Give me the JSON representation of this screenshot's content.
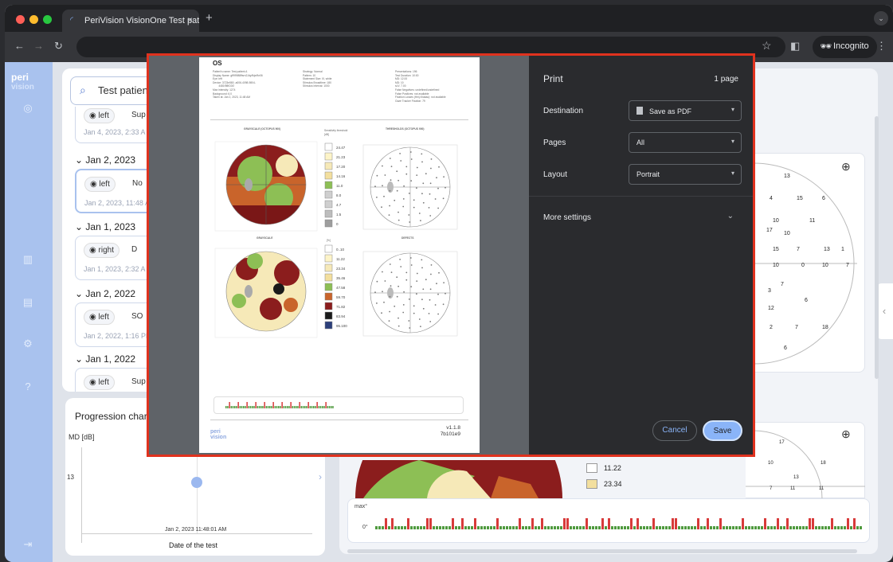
{
  "browser": {
    "tab_title": "PeriVision VisionOne Test pat",
    "tab_close": "×",
    "new_tab": "+",
    "incognito_label": "Incognito"
  },
  "sidebar": {
    "logo_top": "peri",
    "logo_bottom": "vision",
    "icons": [
      "check-circle-icon",
      "bar-chart-icon",
      "calendar-icon",
      "gear-icon",
      "help-icon",
      "logout-icon"
    ]
  },
  "tests": {
    "search_value": "Test patien",
    "groups": [
      {
        "date": "",
        "eye": "left",
        "type": "Sup",
        "timestamp": "Jan 4, 2023, 2:33 A"
      },
      {
        "date": "Jan 2, 2023",
        "eye": "left",
        "type": "No",
        "timestamp": "Jan 2, 2023, 11:48 A"
      },
      {
        "date": "Jan 1, 2023",
        "eye": "right",
        "type": "D",
        "timestamp": "Jan 1, 2023, 2:32 A"
      },
      {
        "date": "Jan 2, 2022",
        "eye": "left",
        "type": "SO",
        "timestamp": "Jan 2, 2022, 1:16 PM"
      },
      {
        "date": "Jan 1, 2022",
        "eye": "left",
        "type": "Sup",
        "timestamp": ""
      }
    ]
  },
  "progression": {
    "title": "Progression char",
    "y_axis_label": "MD [dB]",
    "y_tick": "13",
    "point_date": "Jan 2, 2023 11:48:01 AM",
    "x_axis_label": "Date of the test"
  },
  "main_view": {
    "legend_values": [
      "11.22",
      "23.34"
    ],
    "grid_numbers": [
      "13",
      "4",
      "15",
      "6",
      "10",
      "11",
      "17",
      "10",
      "15",
      "7",
      "13",
      "1",
      "10",
      "0",
      "10",
      "7",
      "7",
      "3",
      "6",
      "12",
      "2",
      "7",
      "18",
      "6"
    ],
    "grid_numbers_lower": [
      "17",
      "10",
      "18",
      "11",
      "7",
      "13",
      "11"
    ],
    "defects_max": "max°",
    "defects_zero": "0°"
  },
  "print_dialog": {
    "title": "Print",
    "page_count": "1 page",
    "destination_label": "Destination",
    "destination_value": "Save as PDF",
    "pages_label": "Pages",
    "pages_value": "All",
    "layout_label": "Layout",
    "layout_value": "Portrait",
    "more_settings": "More settings",
    "cancel": "Cancel",
    "save": "Save"
  },
  "report": {
    "eye": "OS",
    "patient_block": "Patient's name: Test patient A\nDisplay Name: gff99988ffsrn2Jdy/fkje/fkr06\nEye: left\nDevice: 3723e580 -a006-4098-9804-\n        4481f98fC0f2\nMax intensity: 1274\nBackground: 6.0\nTaken at: Jan 2, 2023, 11:48 AM",
    "strategy_block": "Strategy: Normal\nPattern: 10\nStatement Size: III, white\nStimulus Broadtime: 180\nStimulus Interval: 1000",
    "results_block": "Presentations: 196\nTest Duration: 10:00\nMD: 12.00\nMD: 10\nsLV: 7.00\nFalse Negatives: undefined/undefined\nFalse Positives: not available\nFixation Losses (Heij-Krakau): not available\nGaze Tracker Fixation: 79",
    "chart1_title": "GRAYSCALE (OCTOPUS 900)",
    "chart2_title": "THRESHOLDS (OCTOPUS 900)",
    "chart3_title": "GRAYSCALE",
    "chart4_title": "DEFECTS",
    "legend1_title": "Sensitivity threshold [dB]",
    "legend1_values": [
      "24.47",
      "21.23",
      "17.20",
      "14.16",
      "11.0",
      "8.0",
      "4.7",
      "1.5",
      "0"
    ],
    "legend2_title": "[%]",
    "legend2_values": [
      "0..10",
      "11.22",
      "23.34",
      "35.46",
      "47.58",
      "59.70",
      "71.82",
      "83.94",
      "95.100"
    ],
    "version": "v1.1.8",
    "build": "7b101e9",
    "footer_logo_top": "peri",
    "footer_logo_bottom": "vision"
  },
  "colors": {
    "accent": "#8ab4f8",
    "highlight_border": "#e0321e",
    "sidebar": "#a9c2ee",
    "heat_green": "#8dbf55",
    "heat_red": "#8b1d1d",
    "heat_cream": "#f6e9b8",
    "defect_red": "#d83a3a",
    "defect_green": "#4f9a3e"
  }
}
